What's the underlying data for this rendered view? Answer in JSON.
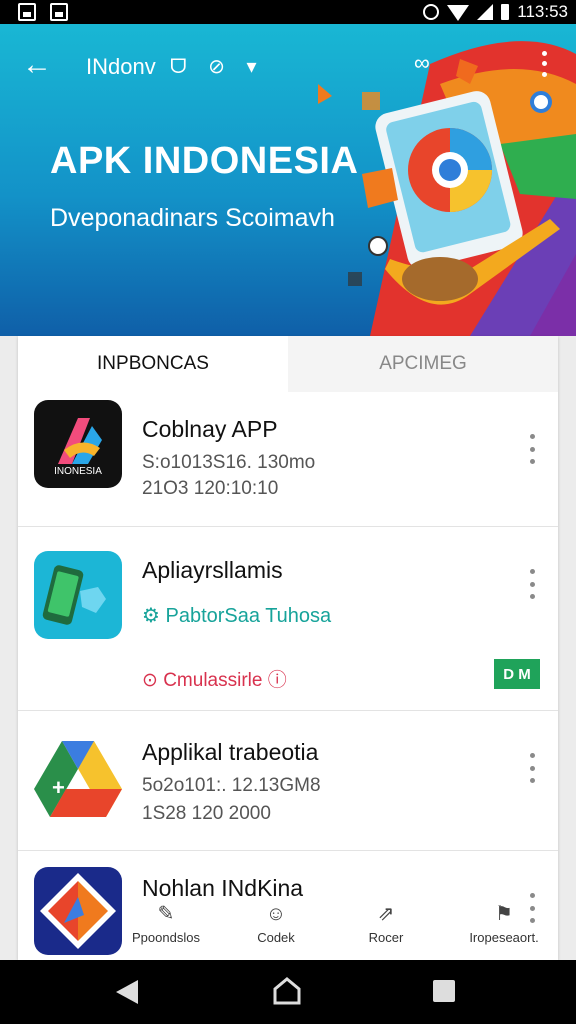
{
  "status_bar": {
    "time": "113:53"
  },
  "header": {
    "back_icon": "arrow-left-icon",
    "toolbar_title": "INdonv",
    "toolbar_icons": "ᗜ ⊘ ▾",
    "link_icon": "link-icon",
    "menu_icon": "overflow-menu-icon",
    "hero_title": "APK INDONESIA",
    "hero_subtitle": "Dveponadinars Scoimavh"
  },
  "tabs": [
    {
      "label": "INPBONCAS",
      "active": true
    },
    {
      "label": "APCIMEG",
      "active": false
    }
  ],
  "apps": [
    {
      "name": "Coblnay APP",
      "line1": "S:o1013S16. 130mo",
      "line2": "21O3 120:10:10",
      "icon_text": "INONESIA"
    },
    {
      "name": "Apliayrsllamis",
      "teal_text": "PabtorSaa Tuhosa",
      "red_text": "Cmulassirle",
      "badge": "D M"
    },
    {
      "name": "Applikal trabeotia",
      "line1": "5o2o101:. 12.13GM8",
      "line2": "1S28 120 2000"
    },
    {
      "name": "Nohlan INdKina"
    }
  ],
  "actions": [
    {
      "label": "Ppoondslos",
      "icon": "edit-icon"
    },
    {
      "label": "Codek",
      "icon": "person-icon"
    },
    {
      "label": "Rocer",
      "icon": "share-icon"
    },
    {
      "label": "Iropeseaort.",
      "icon": "flag-icon"
    }
  ],
  "colors": {
    "header_top": "#19b7d4",
    "header_bottom": "#0f5fa8",
    "teal": "#17a39a",
    "red": "#d8324e",
    "badge": "#1fa35a"
  }
}
